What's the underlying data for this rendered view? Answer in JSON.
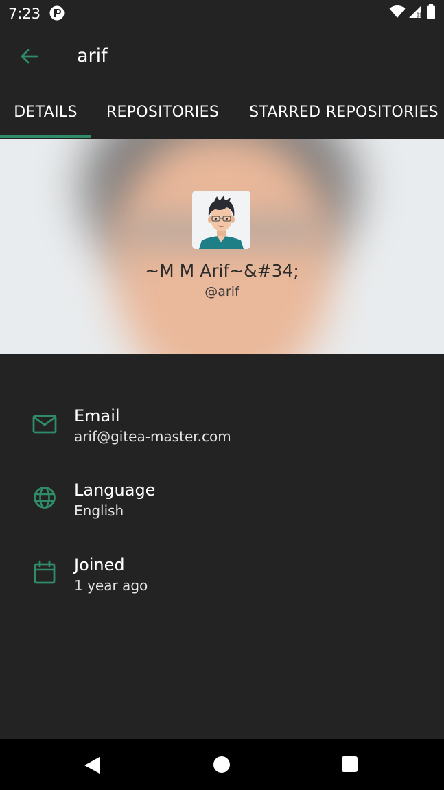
{
  "status_bar": {
    "time": "7:23",
    "icons": [
      "notification-app-icon",
      "wifi-icon",
      "signal-icon",
      "battery-icon"
    ]
  },
  "app_bar": {
    "title": "arif",
    "back_icon": "arrow-back-icon"
  },
  "tabs": [
    {
      "label": "DETAILS",
      "selected": true
    },
    {
      "label": "REPOSITORIES",
      "selected": false
    },
    {
      "label": "STARRED REPOSITORIES",
      "selected": false
    }
  ],
  "profile": {
    "full_name": "~M M Arif~&#34;",
    "username": "@arif"
  },
  "details": [
    {
      "icon": "mail-icon",
      "label": "Email",
      "value": "arif@gitea-master.com"
    },
    {
      "icon": "globe-icon",
      "label": "Language",
      "value": "English"
    },
    {
      "icon": "calendar-icon",
      "label": "Joined",
      "value": "1 year ago"
    }
  ],
  "nav_bar": {
    "buttons": [
      "nav-back-icon",
      "nav-home-icon",
      "nav-recents-icon"
    ]
  },
  "colors": {
    "background": "#232323",
    "accent": "#2f8b68",
    "header_background": "#e9ecee",
    "nav_bar": "#000000"
  }
}
